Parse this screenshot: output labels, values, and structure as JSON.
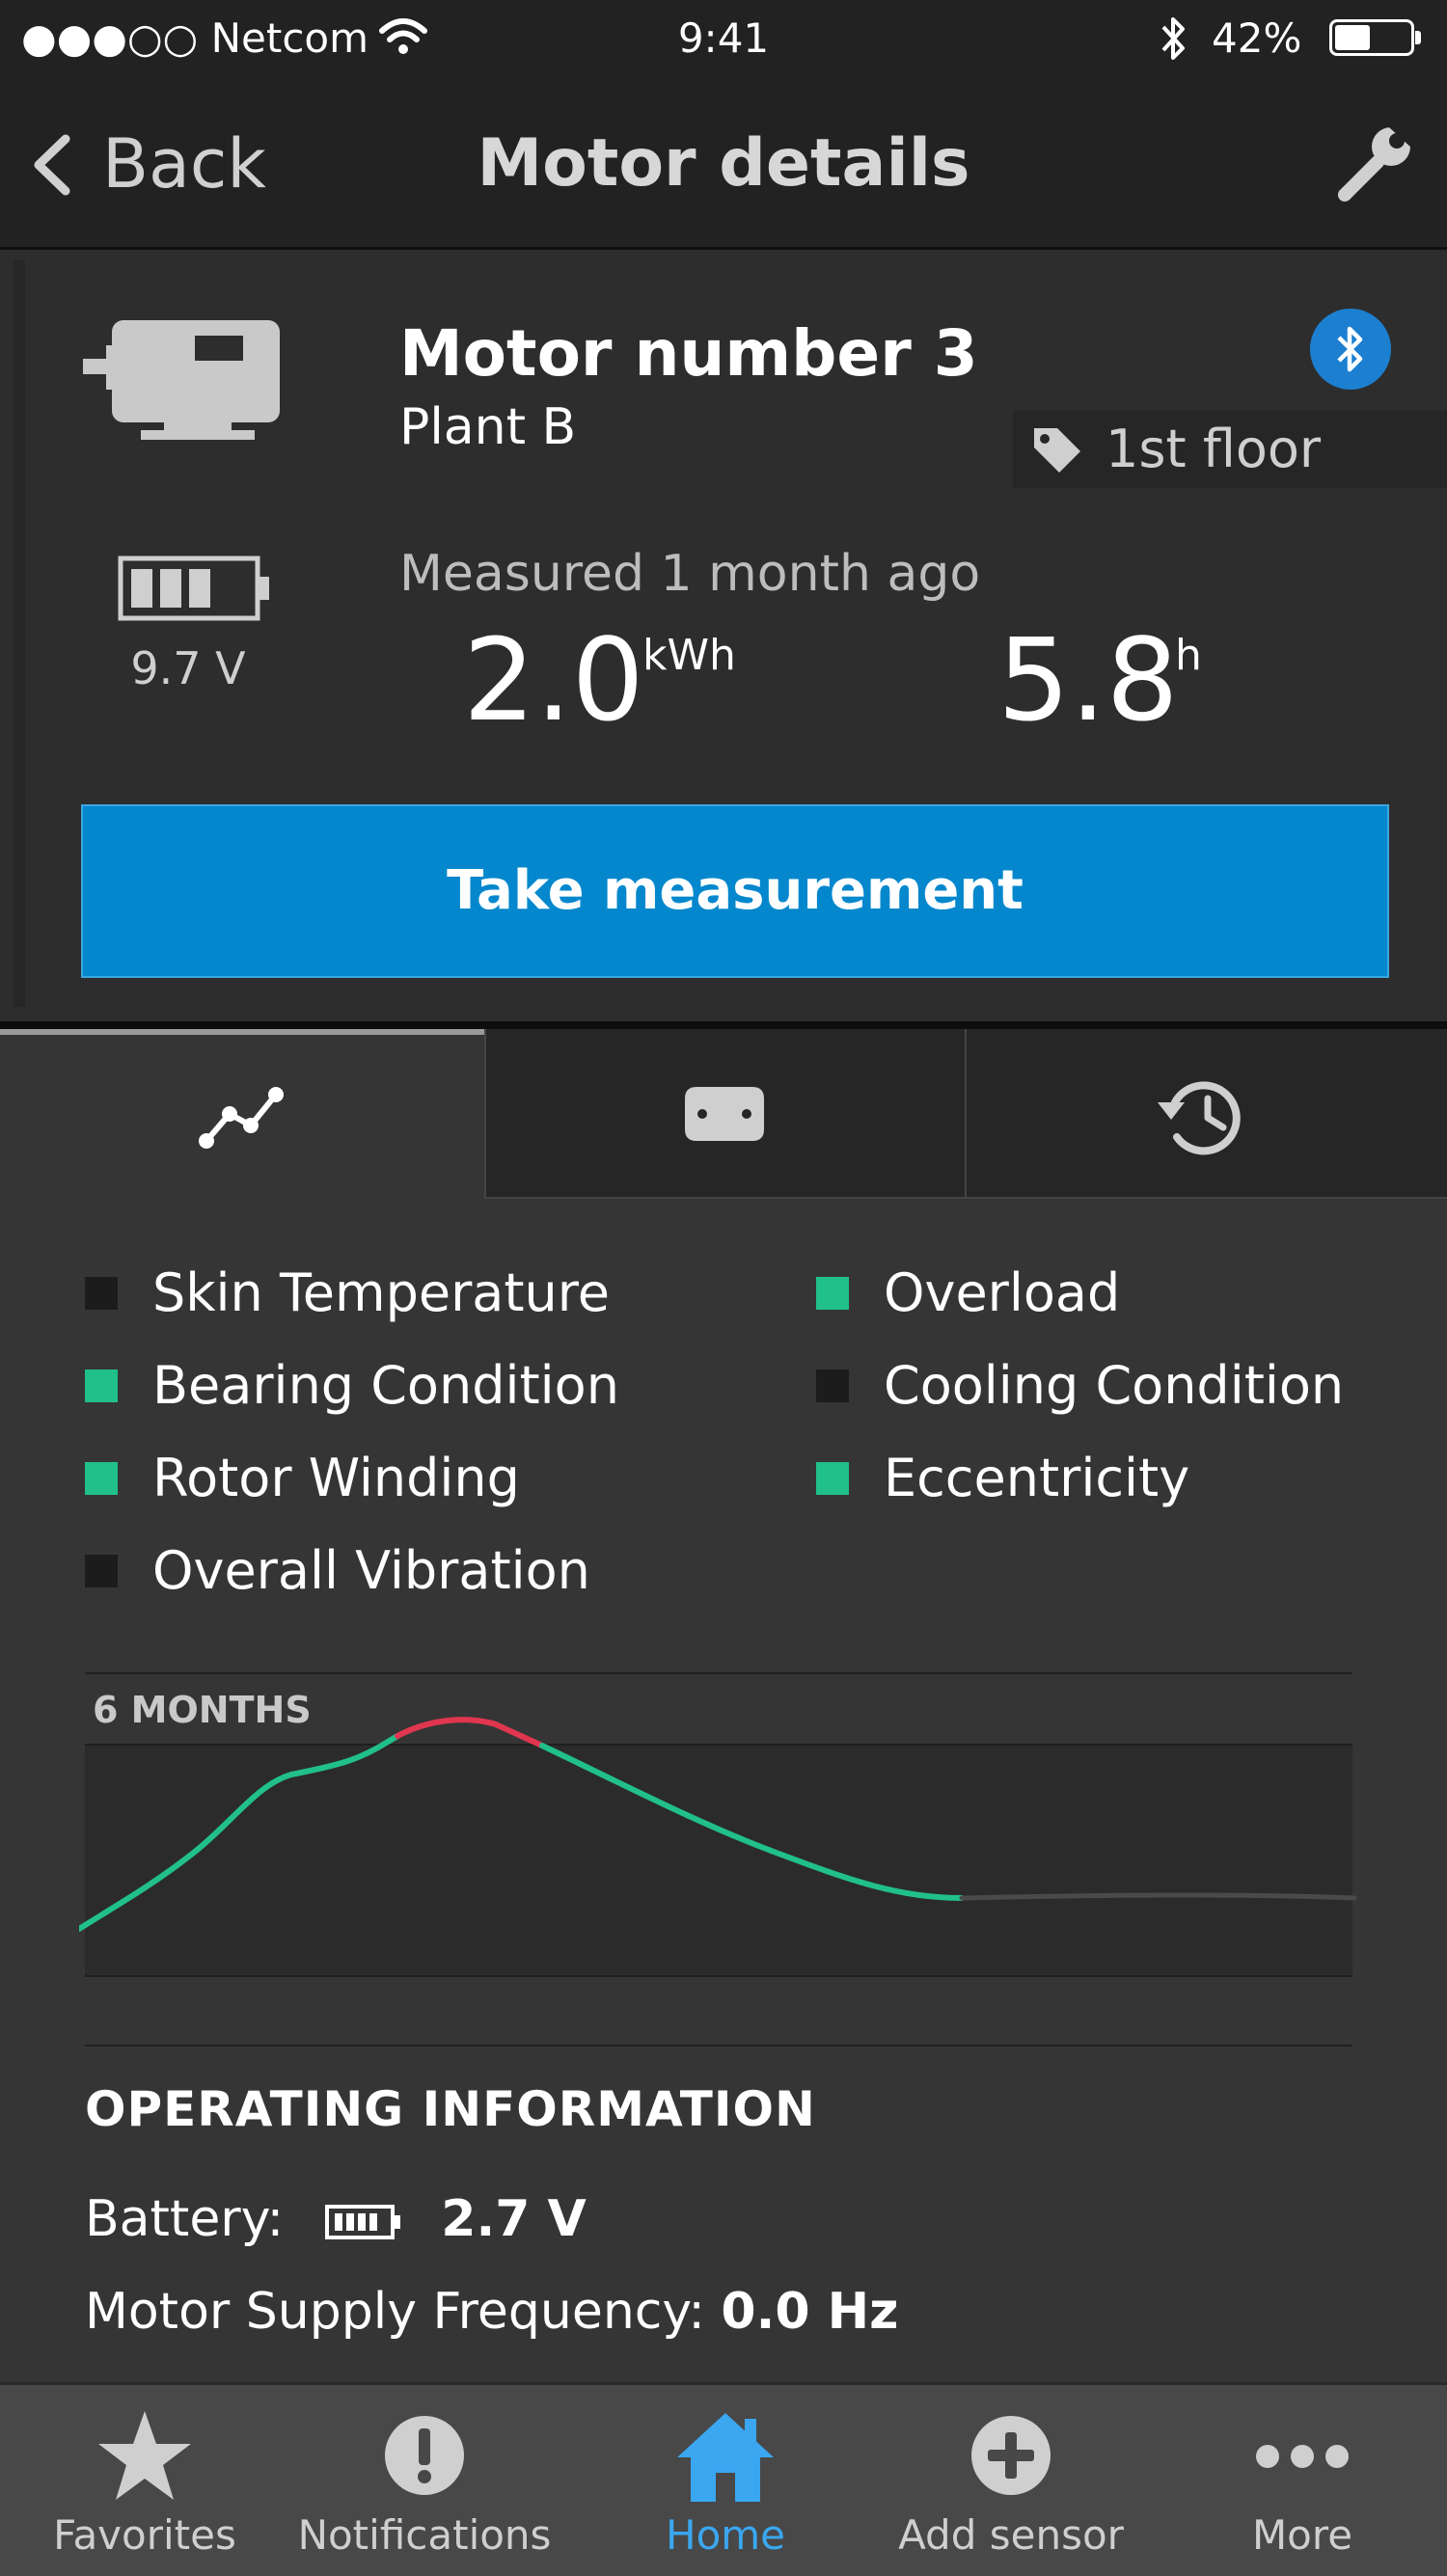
{
  "status_bar": {
    "carrier": "●●●○○ Netcom",
    "time": "9:41",
    "battery": "42%"
  },
  "nav": {
    "back_label": "Back",
    "title": "Motor details"
  },
  "motor": {
    "name": "Motor number 3",
    "plant": "Plant B",
    "tag": "1st floor",
    "sensor_voltage": "9.7 V",
    "measured_text": "Measured 1 month ago",
    "energy_value": "2.0",
    "energy_unit": "kWh",
    "hours_value": "5.8",
    "hours_unit": "h",
    "take_measurement_label": "Take measurement"
  },
  "legend": [
    {
      "label": "Skin Temperature",
      "status": "inactive"
    },
    {
      "label": "Overload",
      "status": "ok"
    },
    {
      "label": "Bearing Condition",
      "status": "ok"
    },
    {
      "label": "Cooling Condition",
      "status": "inactive"
    },
    {
      "label": "Rotor Winding",
      "status": "ok"
    },
    {
      "label": "Eccentricity",
      "status": "ok"
    },
    {
      "label": "Overall Vibration",
      "status": "inactive"
    }
  ],
  "colors": {
    "ok": "#21c08b",
    "inactive": "#1c1c1c",
    "alert": "#e0364f",
    "accent": "#0487cd",
    "home_active": "#3aa7f0"
  },
  "trend": {
    "period_label": "6 MONTHS"
  },
  "operating_info": {
    "title": "OPERATING INFORMATION",
    "battery_label": "Battery:",
    "battery_value": "2.7 V",
    "frequency_label": "Motor Supply Frequency:",
    "frequency_value": "0.0 Hz"
  },
  "tabbar": {
    "items": [
      {
        "label": "Favorites",
        "icon": "star-icon"
      },
      {
        "label": "Notifications",
        "icon": "exclamation-icon"
      },
      {
        "label": "Home",
        "icon": "home-icon",
        "active": true
      },
      {
        "label": "Add sensor",
        "icon": "plus-circle-icon"
      },
      {
        "label": "More",
        "icon": "more-icon"
      }
    ]
  }
}
